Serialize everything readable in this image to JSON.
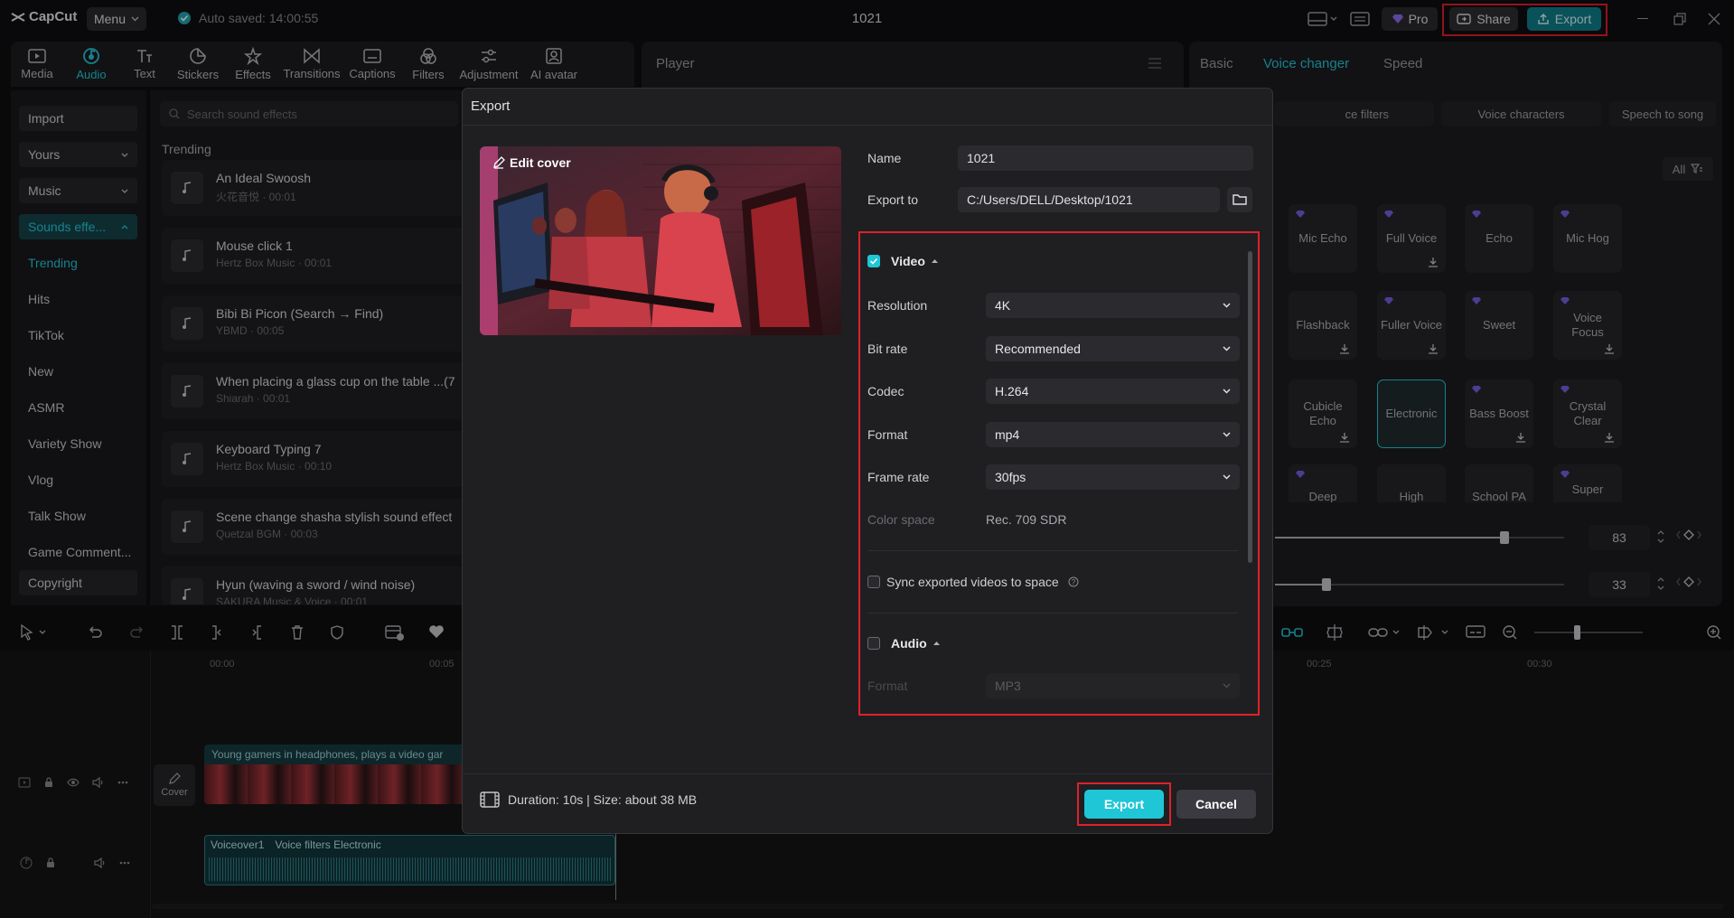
{
  "app": {
    "logo": "CapCut",
    "menu_label": "Menu",
    "autosave": "Auto saved: 14:00:55",
    "doc_title": "1021",
    "pro_label": "Pro",
    "share_label": "Share",
    "export_label": "Export"
  },
  "toolbar": {
    "items": [
      {
        "label": "Media",
        "icon": "media-icon"
      },
      {
        "label": "Audio",
        "icon": "audio-icon"
      },
      {
        "label": "Text",
        "icon": "text-icon"
      },
      {
        "label": "Stickers",
        "icon": "stickers-icon"
      },
      {
        "label": "Effects",
        "icon": "effects-icon"
      },
      {
        "label": "Transitions",
        "icon": "transitions-icon"
      },
      {
        "label": "Captions",
        "icon": "captions-icon"
      },
      {
        "label": "Filters",
        "icon": "filters-icon"
      },
      {
        "label": "Adjustment",
        "icon": "adjustment-icon"
      },
      {
        "label": "AI avatar",
        "icon": "ai-avatar-icon"
      }
    ]
  },
  "leftnav": {
    "import": "Import",
    "yours": "Yours",
    "music": "Music",
    "sound_effects": "Sounds effe...",
    "links": [
      "Trending",
      "Hits",
      "TikTok",
      "New",
      "ASMR",
      "Variety Show",
      "Vlog",
      "Talk Show",
      "Game Comment..."
    ],
    "copyright": "Copyright"
  },
  "sounds": {
    "search_placeholder": "Search sound effects",
    "section": "Trending",
    "items": [
      {
        "title": "An Ideal Swoosh",
        "sub": "火花音悦 · 00:01"
      },
      {
        "title": "Mouse click 1",
        "sub": "Hertz Box Music · 00:01"
      },
      {
        "title": "Bibi Bi Picon (Search → Find)",
        "sub": "YBMD · 00:05"
      },
      {
        "title": "When placing a glass cup on the table ...(7",
        "sub": "Shiarah · 00:01"
      },
      {
        "title": "Keyboard Typing 7",
        "sub": "Hertz Box Music · 00:10"
      },
      {
        "title": "Scene change shasha stylish sound effect",
        "sub": "Quetzal BGM · 00:03"
      },
      {
        "title": "Hyun (waving a sword / wind noise)",
        "sub": "SAKURA Music & Voice · 00:01"
      }
    ]
  },
  "player": {
    "title": "Player"
  },
  "rightpanel": {
    "tabs": [
      "Basic",
      "Voice changer",
      "Speed"
    ],
    "subtabs": [
      "ce filters",
      "Voice characters",
      "Speech to song"
    ],
    "filter_all": "All",
    "cards": [
      "Mic Echo",
      "Full Voice",
      "Echo",
      "Mic Hog",
      "Flashback",
      "Fuller Voice",
      "Sweet",
      "Voice Focus",
      "Cubicle Echo",
      "Electronic",
      "Bass Boost",
      "Crystal Clear",
      "Deep",
      "High",
      "School PA",
      "Super"
    ],
    "slider1_value": "83",
    "slider2_value": "33"
  },
  "timeline": {
    "ruler": [
      "00:00",
      "00:05",
      "00:25",
      "00:30"
    ],
    "video_clip_label": "Young gamers in headphones, plays a video gar",
    "cover_label": "Cover",
    "audio_clip_label1": "Voiceover1",
    "audio_clip_label2": "Voice filters Electronic"
  },
  "dialog": {
    "title": "Export",
    "edit_cover": "Edit cover",
    "name_label": "Name",
    "name_value": "1021",
    "export_to_label": "Export to",
    "export_to_value": "C:/Users/DELL/Desktop/1021",
    "video_section": "Video",
    "video_checked": true,
    "resolution_label": "Resolution",
    "resolution_value": "4K",
    "bitrate_label": "Bit rate",
    "bitrate_value": "Recommended",
    "codec_label": "Codec",
    "codec_value": "H.264",
    "format_label": "Format",
    "format_value": "mp4",
    "framerate_label": "Frame rate",
    "framerate_value": "30fps",
    "colorspace_label": "Color space",
    "colorspace_value": "Rec. 709 SDR",
    "sync_label": "Sync exported videos to space",
    "audio_section": "Audio",
    "audio_format_label": "Format",
    "audio_format_value": "MP3",
    "footer_info": "Duration: 10s | Size: about 38 MB",
    "export_button": "Export",
    "cancel_button": "Cancel"
  },
  "colors": {
    "accent": "#1fc6d6",
    "highlight": "#e0202a"
  }
}
